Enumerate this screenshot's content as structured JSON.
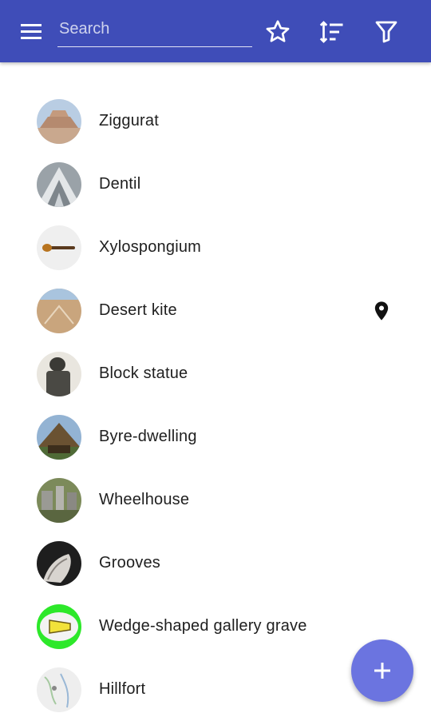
{
  "appbar": {
    "search_placeholder": "Search",
    "menu_icon": "menu-icon",
    "favorites_icon": "star-outline-icon",
    "sort_icon": "sort-icon",
    "filter_icon": "filter-icon",
    "color": "#3f4db8"
  },
  "items": [
    {
      "label": "Ziggurat",
      "pinned": false
    },
    {
      "label": "Dentil",
      "pinned": false
    },
    {
      "label": "Xylospongium",
      "pinned": false
    },
    {
      "label": "Desert kite",
      "pinned": true
    },
    {
      "label": "Block statue",
      "pinned": false
    },
    {
      "label": "Byre-dwelling",
      "pinned": false
    },
    {
      "label": "Wheelhouse",
      "pinned": false
    },
    {
      "label": "Grooves",
      "pinned": false
    },
    {
      "label": "Wedge-shaped gallery grave",
      "pinned": false
    },
    {
      "label": "Hillfort",
      "pinned": false
    }
  ],
  "fab": {
    "icon": "plus-icon",
    "color": "#6b74e0"
  }
}
